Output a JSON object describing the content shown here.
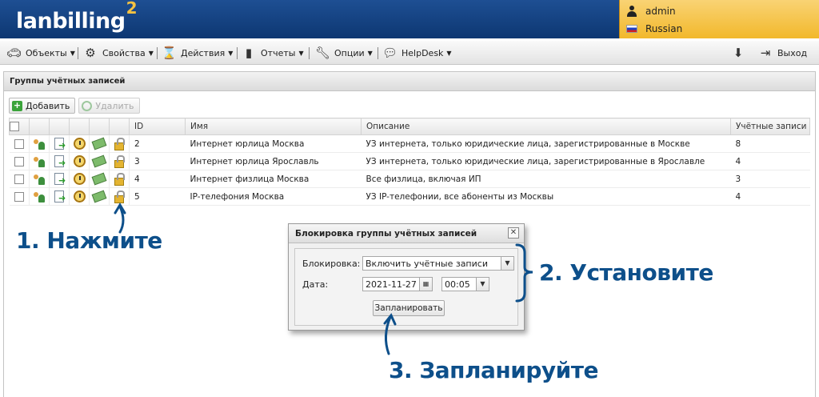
{
  "header": {
    "logo": "lanbilling",
    "logo_sup": "2",
    "user": "admin",
    "language": "Russian"
  },
  "menu": {
    "items": [
      {
        "label": "Объекты"
      },
      {
        "label": "Свойства"
      },
      {
        "label": "Действия"
      },
      {
        "label": "Отчеты"
      },
      {
        "label": "Опции"
      },
      {
        "label": "HelpDesk"
      }
    ],
    "exit_label": "Выход"
  },
  "panel": {
    "title": "Группы учётных записей",
    "add_label": "Добавить",
    "delete_label": "Удалить"
  },
  "table": {
    "headers": {
      "id": "ID",
      "name": "Имя",
      "description": "Описание",
      "accounts": "Учётные записи"
    },
    "rows": [
      {
        "id": "2",
        "name": "Интернет юрлица Москва",
        "description": "УЗ интернета, только юридические лица, зарегистрированные в Москве",
        "accounts": "8"
      },
      {
        "id": "3",
        "name": "Интернет юрлица Ярославль",
        "description": "УЗ интернета, только юридические лица, зарегистрированные в Ярославле",
        "accounts": "4"
      },
      {
        "id": "4",
        "name": "Интернет физлица Москва",
        "description": "Все физлица, включая ИП",
        "accounts": "3"
      },
      {
        "id": "5",
        "name": "IP-телефония Москва",
        "description": "УЗ IP-телефонии, все абоненты из Москвы",
        "accounts": "4"
      }
    ]
  },
  "dialog": {
    "title": "Блокировка группы учётных записей",
    "lock_label": "Блокировка:",
    "lock_value": "Включить учётные записи",
    "date_label": "Дата:",
    "date_value": "2021-11-27",
    "time_value": "00:05",
    "schedule_label": "Запланировать"
  },
  "annotations": {
    "step1": "1. Нажмите",
    "step2": "2. Установите",
    "step3": "3. Запланируйте"
  },
  "colors": {
    "header_blue": "#0d3772",
    "user_box": "#f2b82b",
    "annotation": "#0d4f8a"
  }
}
